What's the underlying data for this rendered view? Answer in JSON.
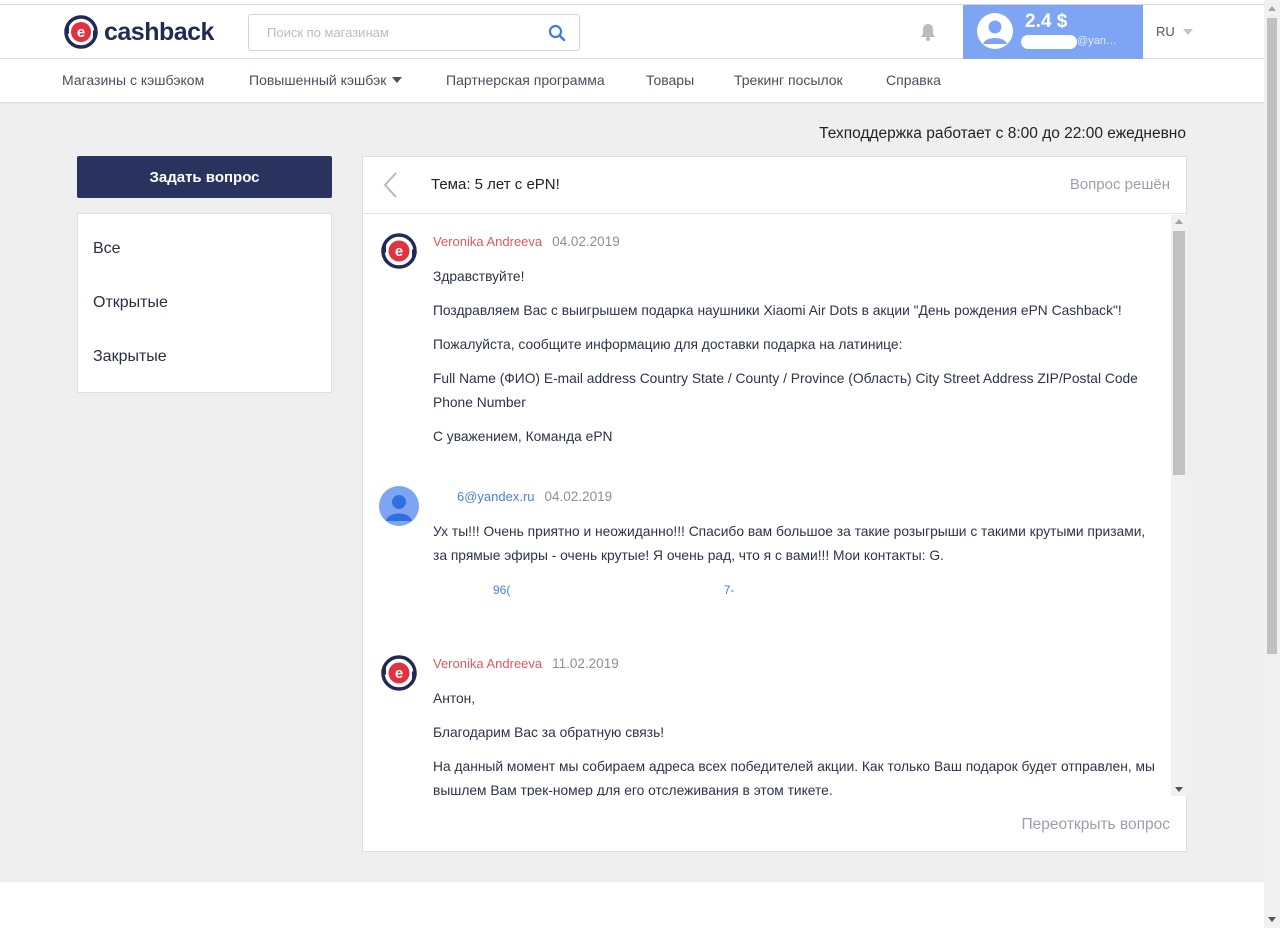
{
  "header": {
    "logo_text": "cashback",
    "search_placeholder": "Поиск по магазинам",
    "balance": "2.4 $",
    "user_email": "@yan…",
    "lang": "RU"
  },
  "nav": {
    "items": [
      {
        "label": "Магазины с кэшбэком"
      },
      {
        "label": "Повышенный кэшбэк"
      },
      {
        "label": "Партнерская программа"
      },
      {
        "label": "Товары"
      },
      {
        "label": "Трекинг посылок"
      },
      {
        "label": "Справка"
      }
    ]
  },
  "support_note": "Техподдержка работает с 8:00 до 22:00 ежедневно",
  "sidebar": {
    "ask_button": "Задать вопрос",
    "filters": [
      {
        "label": "Все"
      },
      {
        "label": "Открытые"
      },
      {
        "label": "Закрытые"
      }
    ]
  },
  "ticket": {
    "title": "Тема: 5 лет с ePN!",
    "status": "Вопрос решён",
    "reopen_label": "Переоткрыть вопрос",
    "messages": [
      {
        "author": "Veronika Andreeva",
        "date": "04.02.2019",
        "paragraphs": [
          "Здравствуйте!",
          "Поздравляем Вас с выигрышем подарка наушники Xiaomi Air Dots в акции \"День рождения ePN Cashback\"!",
          "Пожалуйста, сообщите информацию для доставки подарка на латинице:",
          "Full Name (ФИО) E-mail address Country State / County / Province (Область) City Street Address ZIP/Postal Code Phone Number",
          "С уважением, Команда ePN"
        ]
      },
      {
        "author": "6@yandex.ru",
        "date": "04.02.2019",
        "paragraphs": [
          "Ух ты!!! Очень приятно и неожиданно!!! Спасибо вам большое за такие розыгрыши с такими крутыми призами, за прямые эфиры - очень крутые! Я очень рад, что я с вами!!! Мои контакты: G.",
          "96(                                                                7-"
        ]
      },
      {
        "author": "Veronika Andreeva",
        "date": "11.02.2019",
        "paragraphs": [
          "Антон,",
          "Благодарим Вас за обратную связь!",
          "На данный момент мы собираем адреса всех победителей акции. Как только Ваш подарок будет отправлен, мы вышлем Вам трек-номер для его отслеживания в этом тикете."
        ]
      }
    ]
  },
  "colors": {
    "brand_navy": "#29335e",
    "brand_red": "#e2323f",
    "user_panel": "#7ea5f4",
    "admin_name": "#e25561",
    "user_name": "#4a7fd9"
  }
}
